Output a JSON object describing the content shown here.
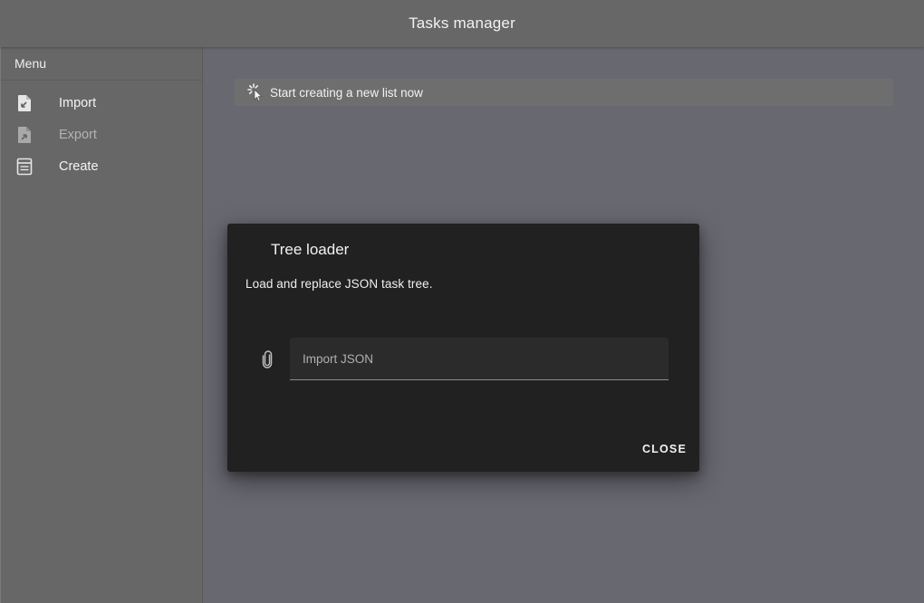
{
  "app": {
    "title": "Tasks manager"
  },
  "sidebar": {
    "header": "Menu",
    "items": [
      {
        "label": "Import",
        "icon": "file-import-icon",
        "disabled": false
      },
      {
        "label": "Export",
        "icon": "file-export-icon",
        "disabled": true
      },
      {
        "label": "Create",
        "icon": "list-create-icon",
        "disabled": false
      }
    ]
  },
  "main": {
    "banner_text": "Start creating a new list now",
    "banner_icon": "cursor-click-icon"
  },
  "dialog": {
    "title": "Tree loader",
    "text": "Load and replace JSON task tree.",
    "file_input_placeholder": "Import JSON",
    "file_input_icon": "paperclip-icon",
    "close_label": "CLOSE"
  },
  "colors": {
    "app_bar": "#676767",
    "page_background": "#686870",
    "dialog_background": "#212121",
    "text_primary": "#f2f2f2",
    "text_disabled": "#b3b3b3"
  }
}
